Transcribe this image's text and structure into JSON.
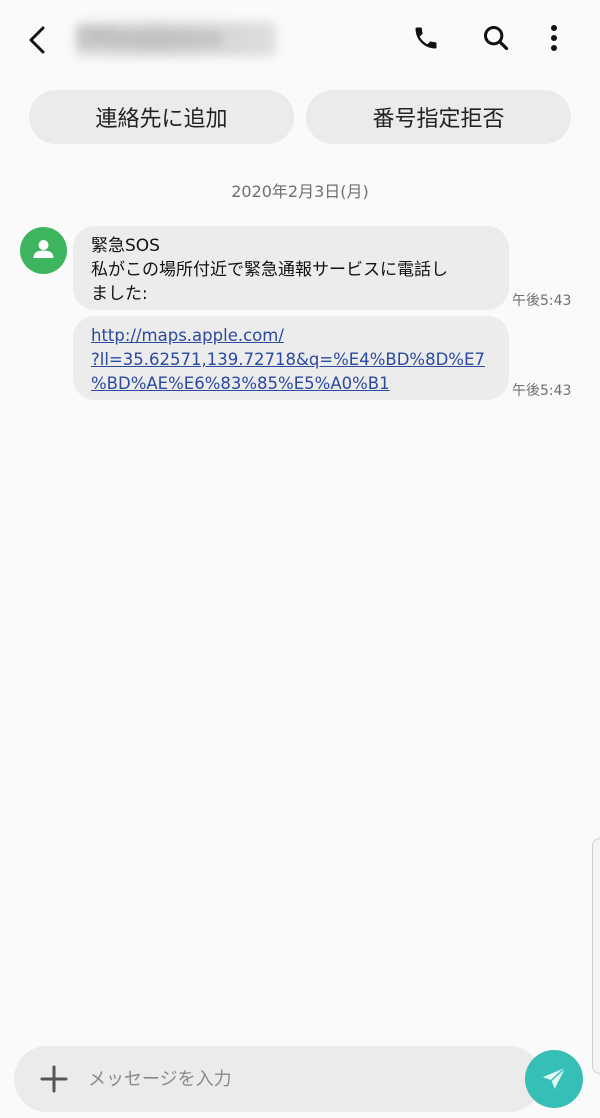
{
  "header": {
    "contact_name": "090xxxxxxxx",
    "back_icon": "chevron-left-icon",
    "call_icon": "phone-icon",
    "search_icon": "search-icon",
    "more_icon": "more-vertical-icon"
  },
  "actions": {
    "add_contact": "連絡先に追加",
    "block_number": "番号指定拒否"
  },
  "conversation": {
    "date": "2020年2月3日(月)",
    "messages": [
      {
        "lines": [
          "緊急SOS",
          "私がこの場所付近で緊急通報サービスに電話し",
          "ました:"
        ],
        "time": "午後5:43"
      },
      {
        "link_lines": [
          "http://maps.apple.com/",
          "?ll=35.62571,139.72718&q=%E4%BD%8D%E7",
          "%BD%AE%E6%83%85%E5%A0%B1"
        ],
        "time": "午後5:43"
      }
    ]
  },
  "composer": {
    "placeholder": "メッセージを入力",
    "value": "",
    "attach_icon": "plus-icon",
    "send_icon": "send-icon"
  },
  "colors": {
    "avatar": "#3db45e",
    "send_button": "#36bfb6",
    "link": "#2a4aa0",
    "bubble": "#ececec",
    "background": "#fafafa"
  }
}
